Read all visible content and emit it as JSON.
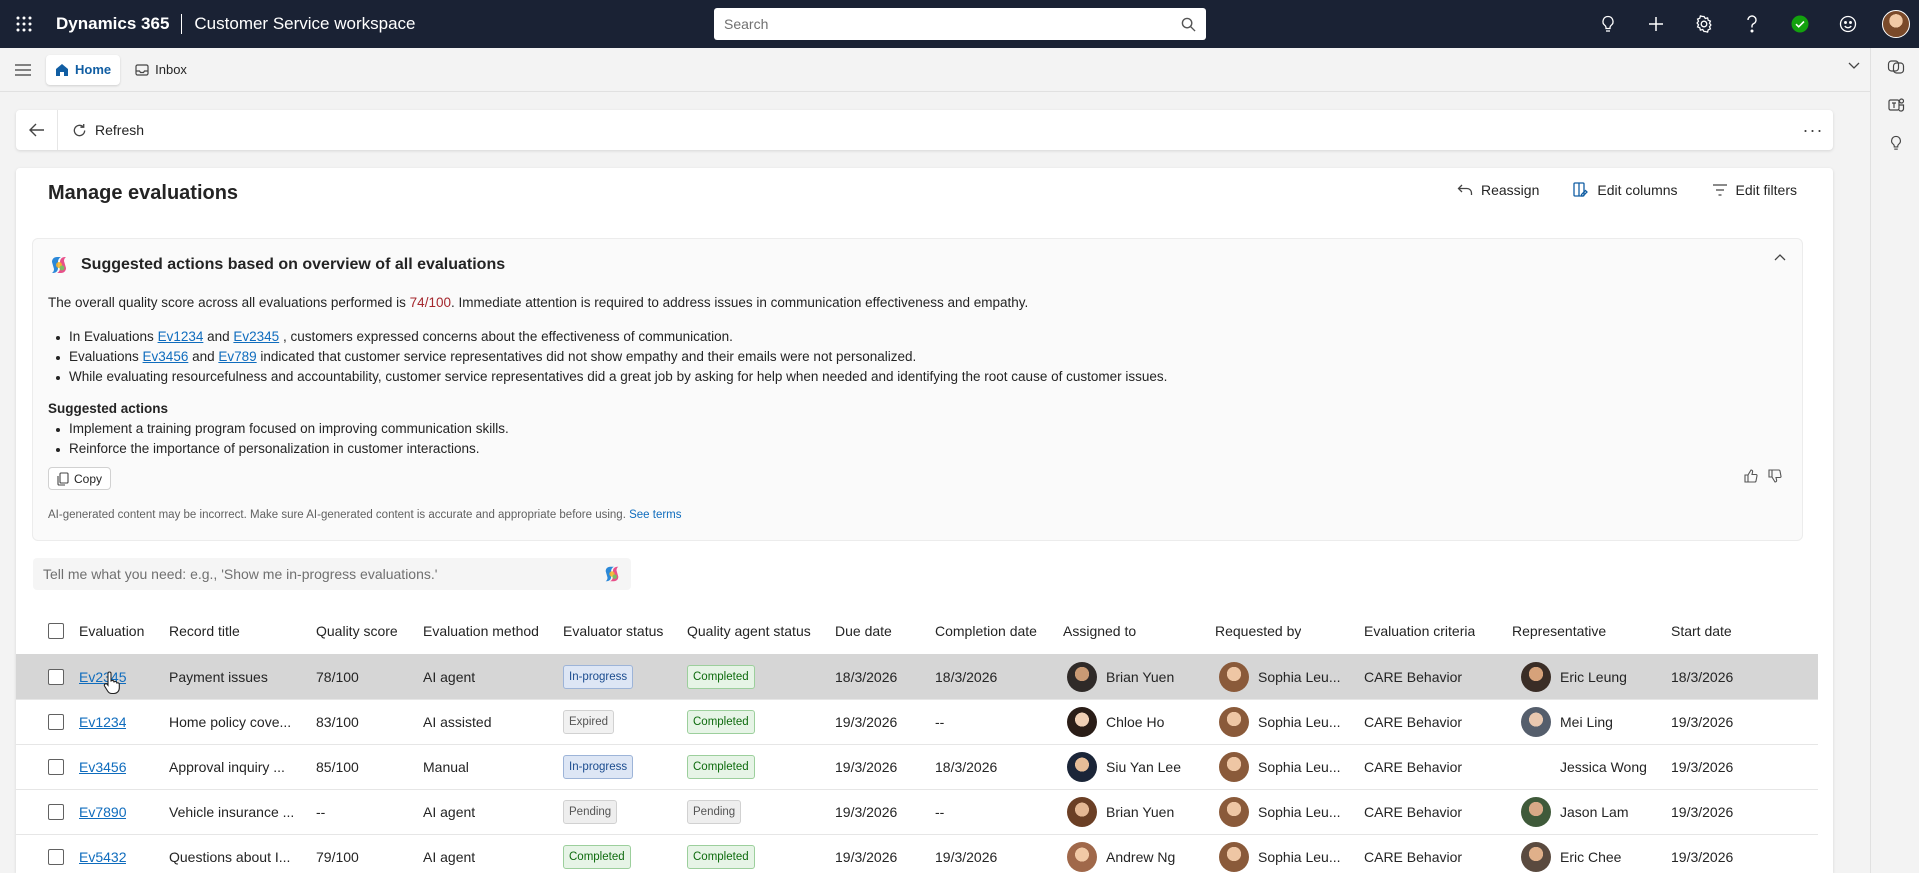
{
  "topbar": {
    "app_name": "Dynamics 365",
    "workspace_name": "Customer Service workspace",
    "search_placeholder": "Search"
  },
  "tabs": [
    {
      "label": "Home",
      "icon": "home-icon",
      "active": true
    },
    {
      "label": "Inbox",
      "icon": "inbox-icon",
      "active": false
    }
  ],
  "commandbar": {
    "refresh_label": "Refresh",
    "more_label": "···"
  },
  "page": {
    "title": "Manage evaluations",
    "actions": {
      "reassign": "Reassign",
      "edit_columns": "Edit columns",
      "edit_filters": "Edit filters"
    }
  },
  "summary": {
    "title": "Suggested actions based on overview of all evaluations",
    "intro_before": "The overall quality score across all evaluations performed is ",
    "intro_score": "74/100",
    "intro_after": ". Immediate attention is required to address issues in communication effectiveness and empathy.",
    "bullet1": {
      "pre": "In Evaluations ",
      "link1": "Ev1234",
      "mid": " and ",
      "link2": "Ev2345",
      "post": " , customers expressed concerns about the effectiveness of communication."
    },
    "bullet2": {
      "pre": "Evaluations ",
      "link1": "Ev3456",
      "mid": " and ",
      "link2": "Ev789",
      "post": " indicated that customer service representatives did not show empathy and their emails were not personalized."
    },
    "bullet3": "While evaluating resourcefulness and accountability, customer service representatives did a great job by asking for help when needed and identifying the root cause of customer issues.",
    "suggested_title": "Suggested actions",
    "suggested": [
      "Implement a training program focused on improving communication skills.",
      "Reinforce the importance of personalization in customer interactions."
    ],
    "copy_label": "Copy",
    "disclaimer": "AI-generated content may be incorrect. Make sure AI-generated content is accurate and appropriate before using.",
    "terms_link": "See terms"
  },
  "nl_input": {
    "placeholder": "Tell me what you need: e.g., 'Show me in-progress evaluations.'"
  },
  "grid": {
    "headers": [
      "Evaluation",
      "Record title",
      "Quality score",
      "Evaluation method",
      "Evaluator status",
      "Quality agent status",
      "Due date",
      "Completion date",
      "Assigned to",
      "Requested by",
      "Evaluation criteria",
      "Representative",
      "Start date"
    ],
    "rows": [
      [
        "Ev2345",
        "Payment issues",
        "78/100",
        "AI agent",
        "In-progress",
        "Completed",
        "18/3/2026",
        "18/3/2026",
        "Brian Yuen",
        "Sophia Leu...",
        "CARE Behavior",
        "Eric Leung",
        "18/3/2026"
      ],
      [
        "Ev1234",
        "Home policy cove...",
        "83/100",
        "AI assisted",
        "Expired",
        "Completed",
        "19/3/2026",
        "--",
        "Chloe Ho",
        "Sophia Leu...",
        "CARE Behavior",
        "Mei Ling",
        "19/3/2026"
      ],
      [
        "Ev3456",
        "Approval inquiry ...",
        "85/100",
        "Manual",
        "In-progress",
        "Completed",
        "19/3/2026",
        "18/3/2026",
        "Siu Yan Lee",
        "Sophia Leu...",
        "CARE Behavior",
        "Jessica Wong",
        "19/3/2026"
      ],
      [
        "Ev7890",
        "Vehicle insurance ...",
        "--",
        "AI agent",
        "Pending",
        "Pending",
        "19/3/2026",
        "--",
        "Brian Yuen",
        "Sophia Leu...",
        "CARE Behavior",
        "Jason Lam",
        "19/3/2026"
      ],
      [
        "Ev5432",
        "Questions about I...",
        "79/100",
        "AI agent",
        "Completed",
        "Completed",
        "19/3/2026",
        "19/3/2026",
        "Andrew Ng",
        "Sophia Leu...",
        "CARE Behavior",
        "Eric Chee",
        "19/3/2026"
      ]
    ]
  },
  "colors": {
    "topbar_bg": "#1a2234",
    "accent": "#0f6cbd",
    "score_highlight": "#a4262c",
    "completed_green": "#0e6b0e",
    "selected_row": "#d6d6d6"
  }
}
